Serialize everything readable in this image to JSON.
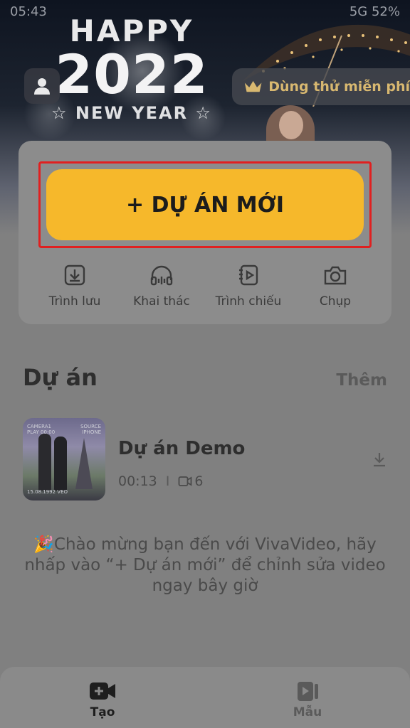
{
  "status_bar": {
    "time": "05:43",
    "right": "5G 52%"
  },
  "banner": {
    "happy": "HAPPY",
    "year": "2022",
    "new_year": "NEW YEAR",
    "trial_label": "Dùng thử miễn phí"
  },
  "new_project_label": "+ DỰ ÁN MỚI",
  "tools": [
    {
      "label": "Trình lưu",
      "icon": "save-icon"
    },
    {
      "label": "Khai thác",
      "icon": "headphones-icon"
    },
    {
      "label": "Trình chiếu",
      "icon": "slideshow-icon"
    },
    {
      "label": "Chụp",
      "icon": "camera-icon"
    }
  ],
  "projects_section": {
    "title": "Dự án",
    "more": "Thêm"
  },
  "project": {
    "name": "Dự án Demo",
    "duration": "00:13",
    "separator": "I",
    "clip_count": "6",
    "thumb_caption_left": "CAMERA1 PLAY 00:00",
    "thumb_caption_right": "SOURCE IPHONE",
    "thumb_caption_bottom": "15.08.1992 VEO"
  },
  "welcome_text": "🎉Chào mừng bạn đến với VivaVideo, hãy nhấp vào “+ Dự án mới” để chỉnh sửa video ngay bây giờ",
  "tabs": [
    {
      "label": "Tạo",
      "icon": "create-video-icon",
      "active": true
    },
    {
      "label": "Mẫu",
      "icon": "template-icon",
      "active": false
    }
  ],
  "colors": {
    "accent": "#f6b82b",
    "highlight_border": "#e02020",
    "trial_text": "#d8b870"
  }
}
